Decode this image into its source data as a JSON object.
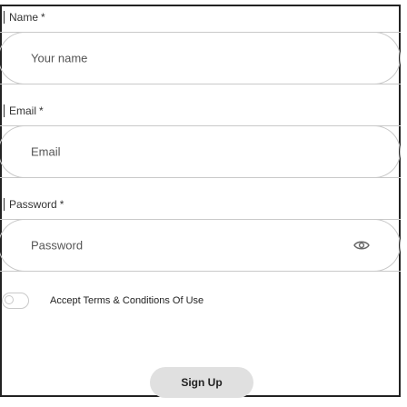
{
  "form": {
    "name": {
      "label": "Name",
      "required_mark": "*",
      "placeholder": "Your name"
    },
    "email": {
      "label": "Email",
      "required_mark": "*",
      "placeholder": "Email"
    },
    "password": {
      "label": "Password",
      "required_mark": "*",
      "placeholder": "Password",
      "toggle_icon": "eye-icon"
    },
    "terms": {
      "label": "Accept Terms & Conditions Of Use",
      "checked": false
    },
    "submit_label": "Sign Up"
  },
  "colors": {
    "border": "#c9c9c9",
    "button_bg": "#e0e0e0",
    "text": "#333333"
  }
}
